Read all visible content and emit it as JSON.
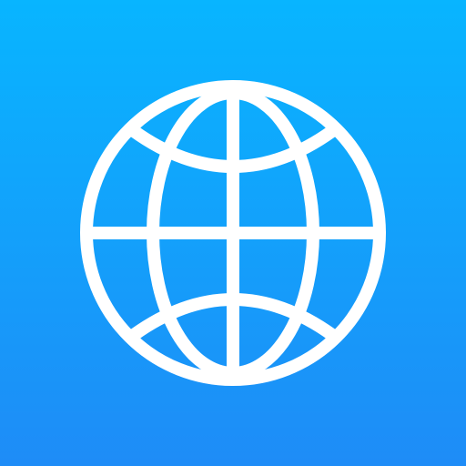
{
  "app_icon": {
    "icon": "globe-icon",
    "colors": {
      "background_top": "#08B5FF",
      "background_bottom": "#1E8CF7",
      "glyph": "#FFFFFF"
    }
  }
}
